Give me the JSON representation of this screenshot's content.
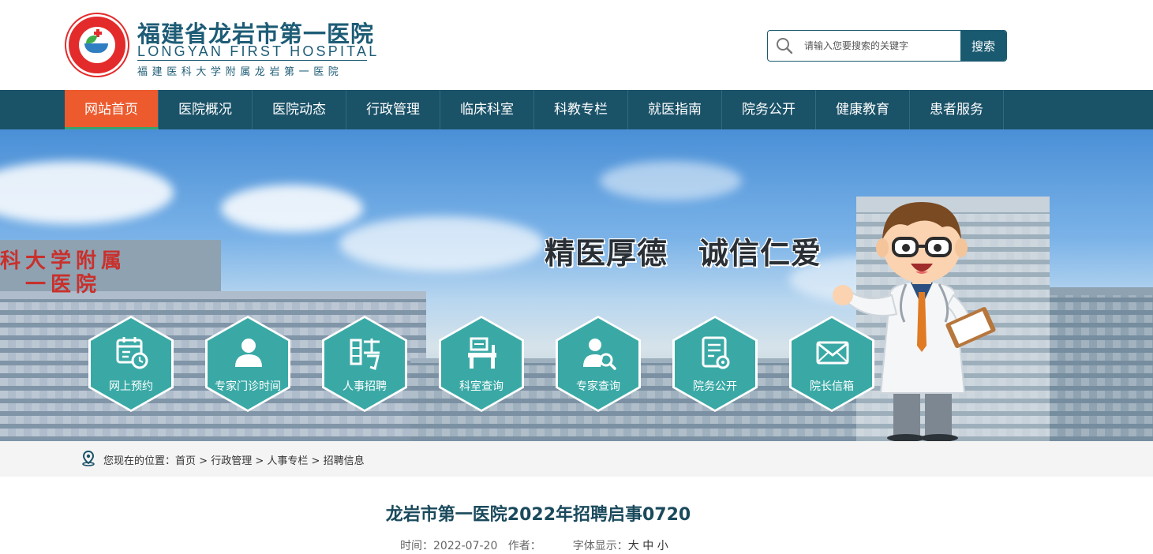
{
  "header": {
    "logo_name_cn": "福建省龙岩市第一医院",
    "logo_name_en": "LONGYAN FIRST HOSPITAL",
    "logo_subtitle": "福建医科大学附属龙岩第一医院",
    "search_placeholder": "请输入您要搜索的关键字",
    "search_button": "搜索"
  },
  "nav": {
    "items": [
      {
        "label": "网站首页",
        "active": true
      },
      {
        "label": "医院概况"
      },
      {
        "label": "医院动态"
      },
      {
        "label": "行政管理"
      },
      {
        "label": "临床科室"
      },
      {
        "label": "科教专栏"
      },
      {
        "label": "就医指南"
      },
      {
        "label": "院务公开"
      },
      {
        "label": "健康教育"
      },
      {
        "label": "患者服务"
      }
    ]
  },
  "banner": {
    "slogan": "精医厚德　诚信仁爱",
    "quick_links": [
      {
        "label": "网上预约",
        "icon": "calendar-clock-icon"
      },
      {
        "label": "专家门诊时间",
        "icon": "person-icon"
      },
      {
        "label": "人事招聘",
        "icon": "recruit-glyph-icon"
      },
      {
        "label": "科室查询",
        "icon": "department-icon"
      },
      {
        "label": "专家查询",
        "icon": "expert-search-icon"
      },
      {
        "label": "院务公开",
        "icon": "document-icon"
      },
      {
        "label": "院长信箱",
        "icon": "mail-icon"
      }
    ]
  },
  "breadcrumb": {
    "prefix": "您现在的位置：",
    "items": [
      "首页",
      "行政管理",
      "人事专栏",
      "招聘信息"
    ],
    "separator": " > "
  },
  "article": {
    "title": "龙岩市第一医院2022年招聘启事0720",
    "time_label": "时间：",
    "time_value": "2022-07-20",
    "author_label": "作者：",
    "author_value": "",
    "font_label": "字体显示：",
    "font_sizes": [
      "大",
      "中",
      "小"
    ]
  },
  "colors": {
    "primary": "#1a5268",
    "active_nav": "#ec5a2e",
    "hex_teal": "#3aa9a6",
    "title": "#1a4a5c"
  }
}
